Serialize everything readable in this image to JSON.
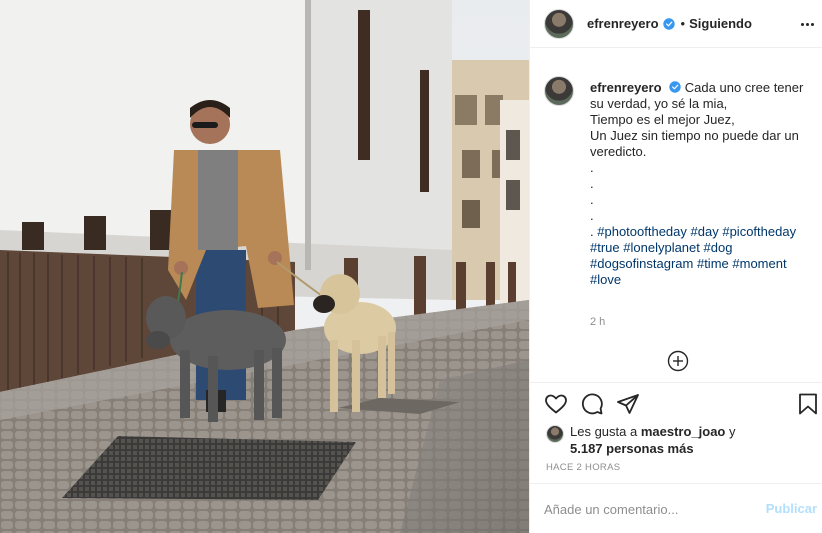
{
  "header": {
    "username": "efrenreyero",
    "separator": "•",
    "follow_status": "Siguiendo",
    "icons": {
      "verified": "verified-badge-icon",
      "more": "more-options-icon"
    }
  },
  "caption": {
    "username": "efrenreyero",
    "lines": [
      "Cada uno cree tener su verdad, yo sé la mia,",
      "Tiempo es el mejor Juez,",
      "Un Juez sin tiempo no puede dar un veredicto.",
      ".",
      ".",
      ".",
      ".",
      "."
    ],
    "hashtag_prefix": ".",
    "hashtags": [
      "#photooftheday",
      "#day",
      "#picoftheday",
      "#true",
      "#lonelyplanet",
      "#dog",
      "#dogsofinstagram",
      "#time",
      "#moment",
      "#love"
    ],
    "time": "2 h"
  },
  "actions": {
    "icons": [
      "heart-icon",
      "comment-icon",
      "share-icon",
      "bookmark-icon"
    ],
    "likes_prefix": "Les gusta a",
    "liked_by": "maestro_joao",
    "likes_and": "y",
    "likes_others": "5.187 personas más",
    "time_ago": "HACE 2 HORAS"
  },
  "comment": {
    "placeholder": "Añade un comentario...",
    "publish_label": "Publicar"
  },
  "colors": {
    "verified": "#3897f0",
    "hashtag": "#00376b",
    "publish_disabled": "#b2dffc",
    "muted": "#8e8e8e",
    "border": "#efefef"
  }
}
